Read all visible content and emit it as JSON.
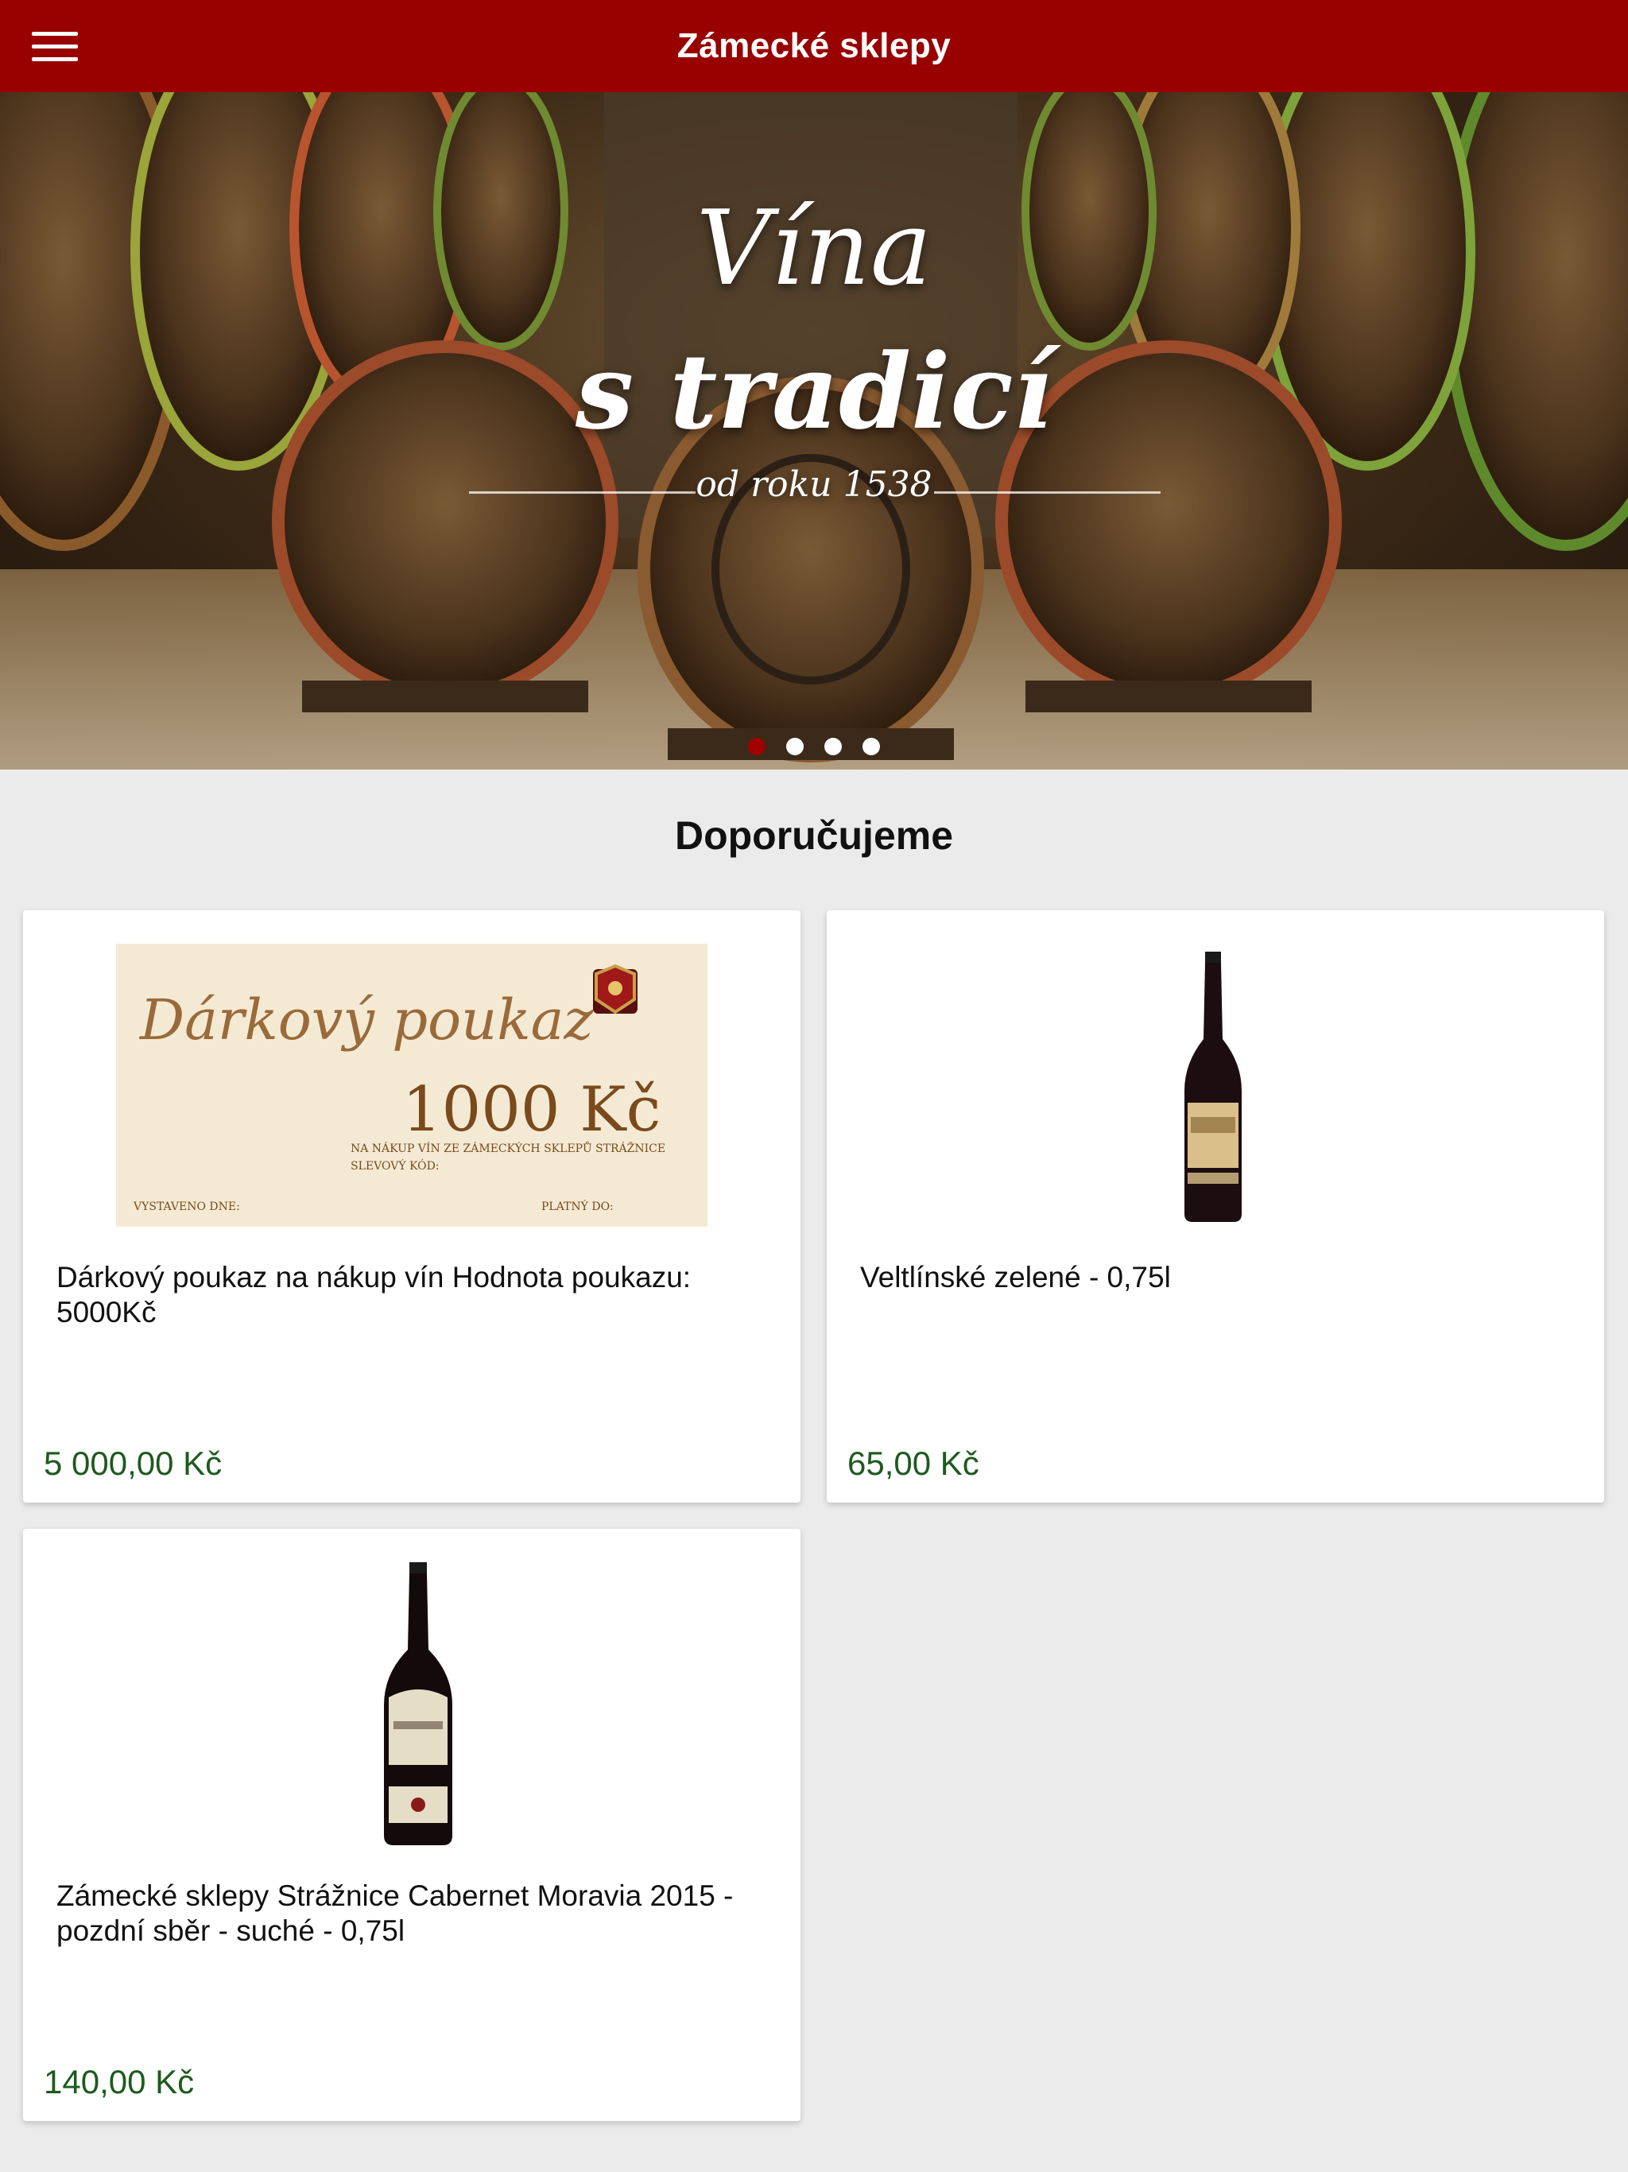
{
  "app": {
    "title": "Zámecké sklepy"
  },
  "icons": {
    "menu": "hamburger-menu-icon"
  },
  "colors": {
    "brand": "#990000",
    "price": "#1e5a1e",
    "background": "#ebebeb"
  },
  "hero": {
    "line1": "Vína",
    "line2": "s tradicí",
    "subtitle": "od roku 1538",
    "slides_total": 4,
    "active_slide": 1
  },
  "section": {
    "title": "Doporučujeme"
  },
  "products": [
    {
      "name": "Dárkový poukaz na nákup vín Hodnota poukazu: 5000Kč",
      "price": "5 000,00 Kč",
      "voucher": {
        "heading": "Dárkový poukaz",
        "amount": "1000 Kč",
        "line": "NA NÁKUP VÍN ZE ZÁMECKÝCH SKLEPŮ STRÁŽNICE",
        "code_label": "SLEVOVÝ KÓD:",
        "issued_label": "VYSTAVENO DNE:",
        "valid_label": "PLATNÝ DO:"
      }
    },
    {
      "name": "Veltlínské zelené - 0,75l",
      "price": "65,00 Kč"
    },
    {
      "name": "Zámecké sklepy Strážnice Cabernet Moravia 2015 - pozdní sběr - suché - 0,75l",
      "price": "140,00 Kč"
    }
  ]
}
